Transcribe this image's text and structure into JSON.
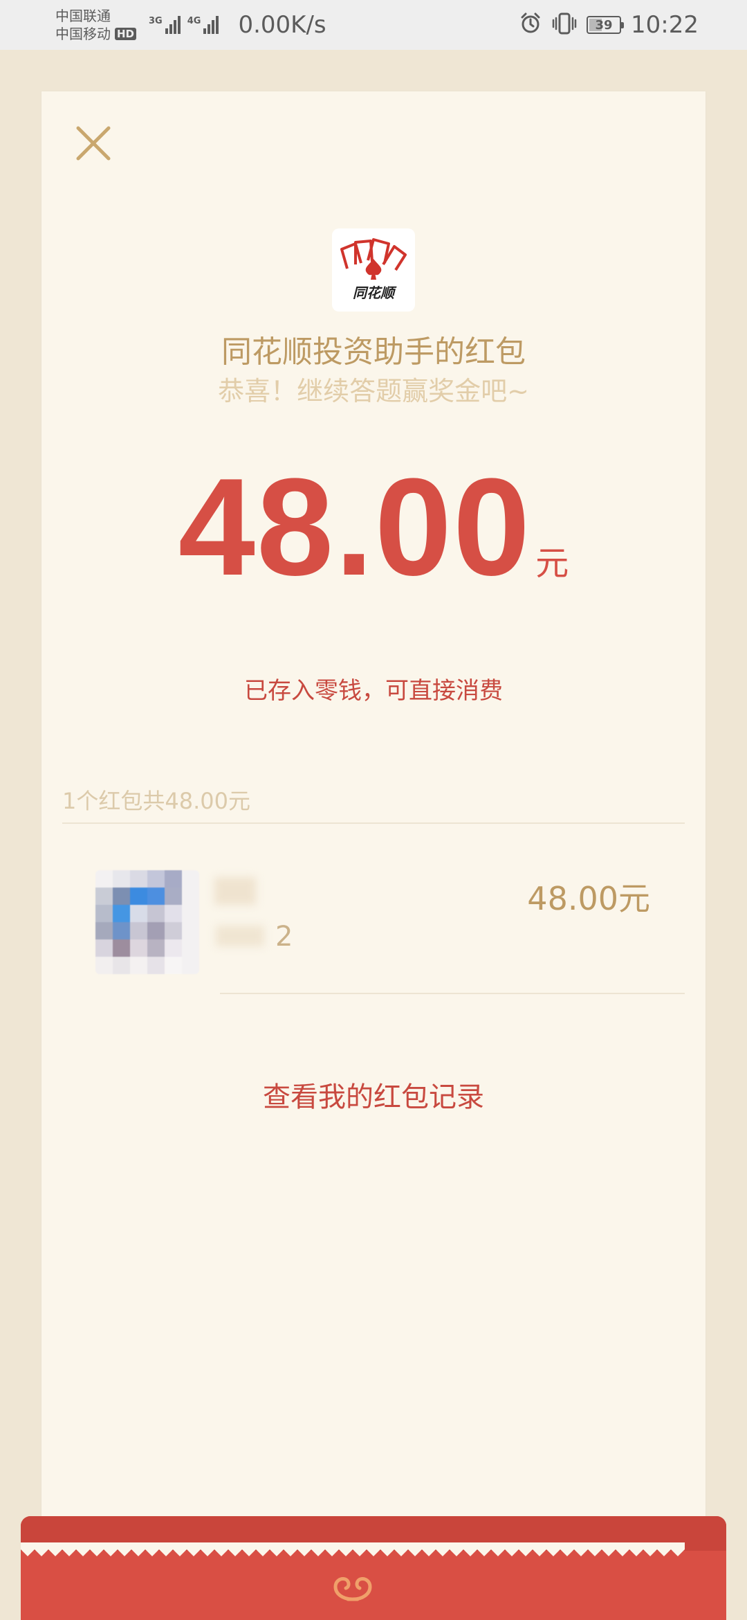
{
  "status_bar": {
    "carrier1": "中国联通",
    "carrier2": "中国移动",
    "hd_badge": "HD",
    "signal1_label": "3G",
    "signal2_label": "4G",
    "net_speed": "0.00K/s",
    "battery": "39",
    "time": "10:22",
    "icons": [
      "alarm-icon",
      "vibrate-icon",
      "battery-icon"
    ]
  },
  "card": {
    "logo_text": "同花顺",
    "title": "同花顺投资助手的红包",
    "subtitle": "恭喜！继续答题赢奖金吧~",
    "amount": "48.00",
    "amount_unit": "元",
    "stored_note": "已存入零钱，可直接消费",
    "summary": "1个红包共48.00元",
    "item": {
      "sub_digit": "2",
      "amount": "48.00元"
    },
    "record_link": "查看我的红包记录"
  },
  "colors": {
    "accent_red": "#D64F45",
    "gold": "#BD9A63",
    "card_bg": "#FBF6EB",
    "page_bg": "#EFE6D4"
  }
}
